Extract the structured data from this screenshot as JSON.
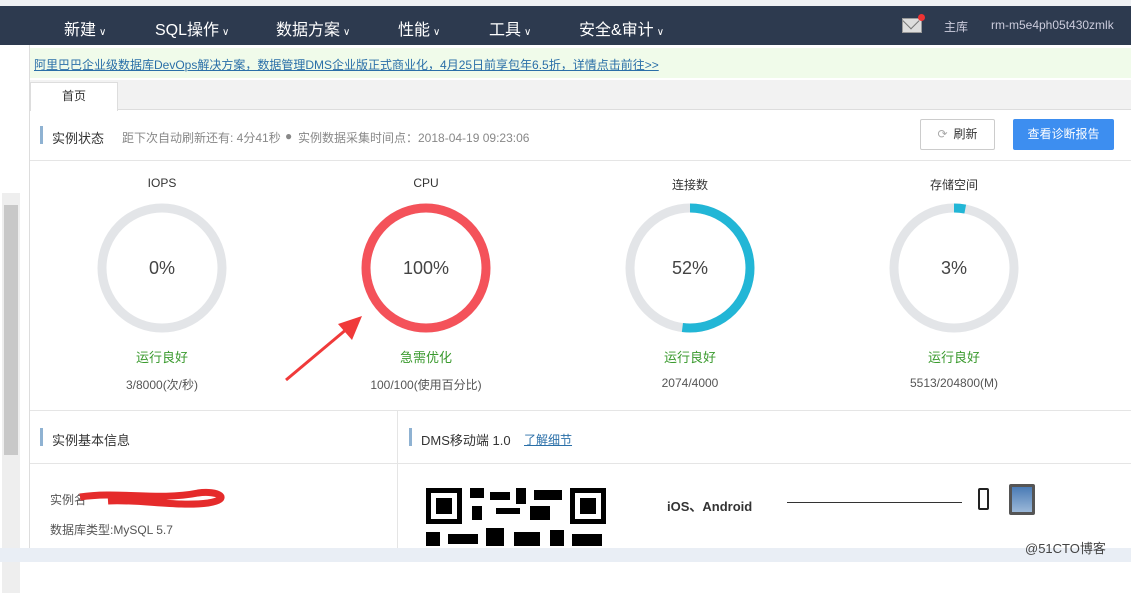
{
  "nav": {
    "items": [
      "新建",
      "SQL操作",
      "数据方案",
      "性能",
      "工具",
      "安全&审计"
    ],
    "role": "主库",
    "instance": "rm-m5e4ph05t430zmlk"
  },
  "banner": "阿里巴巴企业级数据库DevOps解决方案，数据管理DMS企业版正式商业化，4月25日前享包年6.5折，详情点击前往>>",
  "tabs": [
    "首页"
  ],
  "status": {
    "title": "实例状态",
    "refresh_countdown": "距下次自动刷新还有: 4分41秒",
    "collect_time": "实例数据采集时间点：2018-04-19 09:23:06",
    "refresh_label": "刷新",
    "report_label": "查看诊断报告"
  },
  "gauges": [
    {
      "title": "IOPS",
      "percent": 0,
      "percent_label": "0%",
      "status": "运行良好",
      "value": "3/8000(次/秒)",
      "color": "#22b6d6"
    },
    {
      "title": "CPU",
      "percent": 100,
      "percent_label": "100%",
      "status": "急需优化",
      "value": "100/100(使用百分比)",
      "color": "#f4525a"
    },
    {
      "title": "连接数",
      "percent": 52,
      "percent_label": "52%",
      "status": "运行良好",
      "value": "2074/4000",
      "color": "#22b6d6"
    },
    {
      "title": "存储空间",
      "percent": 3,
      "percent_label": "3%",
      "status": "运行良好",
      "value": "5513/204800(M)",
      "color": "#22b6d6"
    }
  ],
  "info": {
    "title": "实例基本信息",
    "name_label": "实例名",
    "db_type": "数据库类型:MySQL 5.7"
  },
  "mobile": {
    "title": "DMS移动端 1.0",
    "link": "了解细节",
    "platforms": "iOS、Android"
  },
  "watermark": "@51CTO博客"
}
